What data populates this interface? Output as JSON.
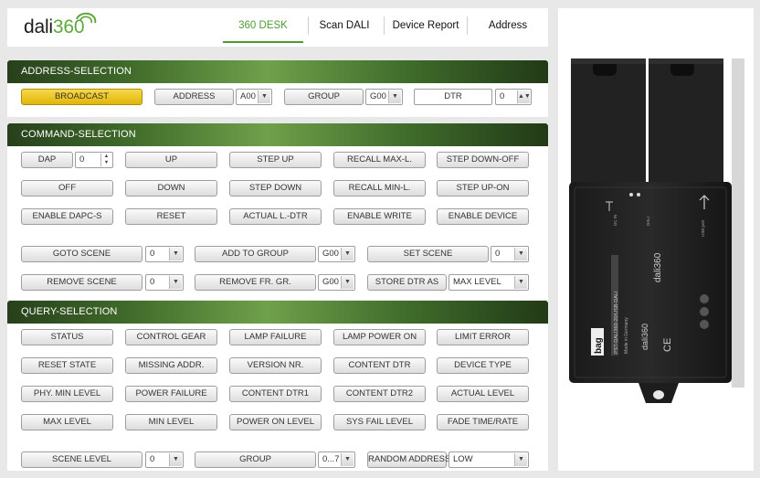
{
  "logo": {
    "text": "dali",
    "num": "360"
  },
  "nav": [
    {
      "label": "360 DESK"
    },
    {
      "label": "Scan DALI"
    },
    {
      "label": "Device Report"
    },
    {
      "label": "Address"
    }
  ],
  "address_panel": {
    "title": "ADDRESS-SELECTION",
    "broadcast": "BROADCAST",
    "address": "ADDRESS",
    "address_value": "A00",
    "group": "GROUP",
    "group_value": "G00",
    "dtr": "DTR",
    "dtr_value": "0"
  },
  "command_panel": {
    "title": "COMMAND-SELECTION",
    "dap": "DAP",
    "dap_value": "0",
    "row1": [
      "UP",
      "STEP UP",
      "RECALL MAX-L.",
      "STEP DOWN-OFF"
    ],
    "row2": [
      "OFF",
      "DOWN",
      "STEP DOWN",
      "RECALL MIN-L.",
      "STEP UP-ON"
    ],
    "row3": [
      "ENABLE DAPC-S",
      "RESET",
      "ACTUAL L.-DTR",
      "ENABLE WRITE",
      "ENABLE DEVICE"
    ],
    "goto_scene": "GOTO SCENE",
    "goto_scene_value": "0",
    "add_to_group": "ADD TO GROUP",
    "add_to_group_value": "G00",
    "set_scene": "SET SCENE",
    "set_scene_value": "0",
    "remove_scene": "REMOVE SCENE",
    "remove_scene_value": "0",
    "remove_fr_gr": "REMOVE FR. GR.",
    "remove_fr_gr_value": "G00",
    "store_dtr_as": "STORE DTR AS",
    "store_dtr_as_value": "MAX LEVEL"
  },
  "query_panel": {
    "title": "QUERY-SELECTION",
    "row1": [
      "STATUS",
      "CONTROL GEAR",
      "LAMP FAILURE",
      "LAMP POWER ON",
      "LIMIT ERROR"
    ],
    "row2": [
      "RESET STATE",
      "MISSING ADDR.",
      "VERSION NR.",
      "CONTENT DTR",
      "DEVICE TYPE"
    ],
    "row3": [
      "PHY. MIN LEVEL",
      "POWER FAILURE",
      "CONTENT DTR1",
      "CONTENT DTR2",
      "ACTUAL LEVEL"
    ],
    "row4": [
      "MAX LEVEL",
      "MIN LEVEL",
      "POWER ON LEVEL",
      "SYS FAIL LEVEL",
      "FADE TIME/RATE"
    ],
    "scene_level": "SCENE LEVEL",
    "scene_level_value": "0",
    "group": "GROUP",
    "group_value": "0...7",
    "random_address": "RANDOM ADDRESS",
    "random_address_value": "LOW"
  },
  "device": {
    "brand": "bag",
    "logo1": "dali360",
    "logo2": "dali360",
    "text_block": "PST-DALI360-20/USB-DALI",
    "text_sub": "Made in Germany",
    "port_dc": "DC IN",
    "port_dali": "DALI",
    "port_usb": "USB port"
  }
}
